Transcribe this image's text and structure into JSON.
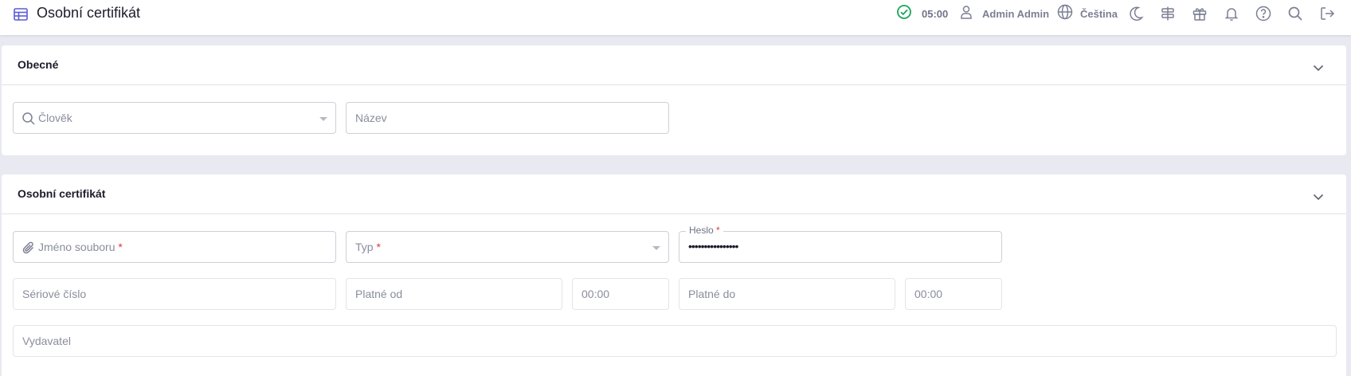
{
  "header": {
    "title": "Osobní certifikát",
    "page_icon": "table-icon",
    "timer": "05:00",
    "user": "Admin Admin",
    "language": "Čeština",
    "accent_color": "#5b5bd6",
    "timer_color": "#1aa35a"
  },
  "sections": {
    "general": {
      "title": "Obecné",
      "person_placeholder": "Člověk",
      "name_placeholder": "Název"
    },
    "certificate": {
      "title": "Osobní certifikát",
      "file_name_label": "Jméno souboru",
      "type_label": "Typ",
      "password_label": "Heslo",
      "password_value": "••••••••••••••••",
      "required_mark": "*",
      "serial_label": "Sériové číslo",
      "valid_from_label": "Platné od",
      "valid_from_time": "00:00",
      "valid_to_label": "Platné do",
      "valid_to_time": "00:00",
      "issuer_label": "Vydavatel"
    }
  }
}
